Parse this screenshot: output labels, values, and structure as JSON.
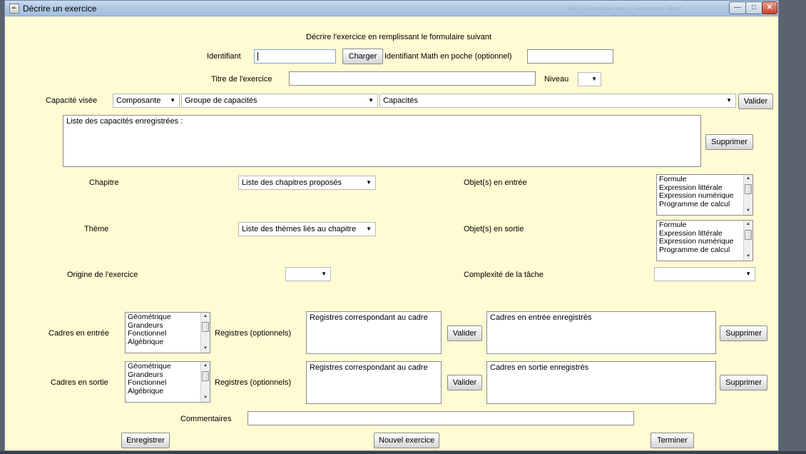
{
  "window": {
    "title": "Décrire un exercice",
    "ghost_title": "Bac/Technique.docx - Microsoft Word"
  },
  "header": {
    "instruction": "Décrire l'exercice en remplissant le formulaire suivant"
  },
  "identification": {
    "id_label": "Identifiant",
    "id_value": "",
    "load_button": "Charger",
    "mathenpoche_label": "Identifiant Math en poche (optionnel)",
    "mathenpoche_value": "",
    "title_label": "Titre de l'exercice",
    "title_value": "",
    "level_label": "Niveau",
    "level_value": ""
  },
  "capacity": {
    "label": "Capacité visée",
    "component_select": "Composante",
    "group_select": "Groupe de capacités",
    "capacities_select": "Capacités",
    "validate_button": "Valider",
    "registered_list_header": "Liste des capacités enregistrées :",
    "delete_button": "Supprimer"
  },
  "chapter": {
    "label": "Chapitre",
    "select": "Liste des chapitres proposés"
  },
  "theme": {
    "label": "Thème",
    "select": "Liste des thèmes liés au chapitre"
  },
  "origin": {
    "label": "Origine de l'exercice",
    "select": ""
  },
  "complexity": {
    "label": "Complexité de la tâche",
    "select": ""
  },
  "objects_in": {
    "label": "Objet(s) en entrée",
    "items": [
      "Formule",
      "Expression littérale",
      "Expression numérique",
      "Programme de calcul"
    ]
  },
  "objects_out": {
    "label": "Objet(s) en sortie",
    "items": [
      "Formule",
      "Expression littérale",
      "Expression numérique",
      "Programme de calcul"
    ]
  },
  "frames_in": {
    "label": "Cadres en entrée",
    "items": [
      "Géométrique",
      "Grandeurs",
      "Fonctionnel",
      "Algébrique"
    ],
    "registers_label": "Registres (optionnels)",
    "registers_header": "Registres correspondant au cadre",
    "validate_button": "Valider",
    "registered_header": "Cadres en entrée enregistrés",
    "delete_button": "Supprimer"
  },
  "frames_out": {
    "label": "Cadres en sortie",
    "items": [
      "Géométrique",
      "Grandeurs",
      "Fonctionnel",
      "Algébrique"
    ],
    "registers_label": "Registres (optionnels)",
    "registers_header": "Registres correspondant au cadre",
    "validate_button": "Valider",
    "registered_header": "Cadres en sortie enregistrés",
    "delete_button": "Supprimer"
  },
  "comments": {
    "label": "Commentaires",
    "value": ""
  },
  "footer": {
    "save_button": "Enregistrer",
    "new_button": "Nouvel exercice",
    "finish_button": "Terminer"
  }
}
